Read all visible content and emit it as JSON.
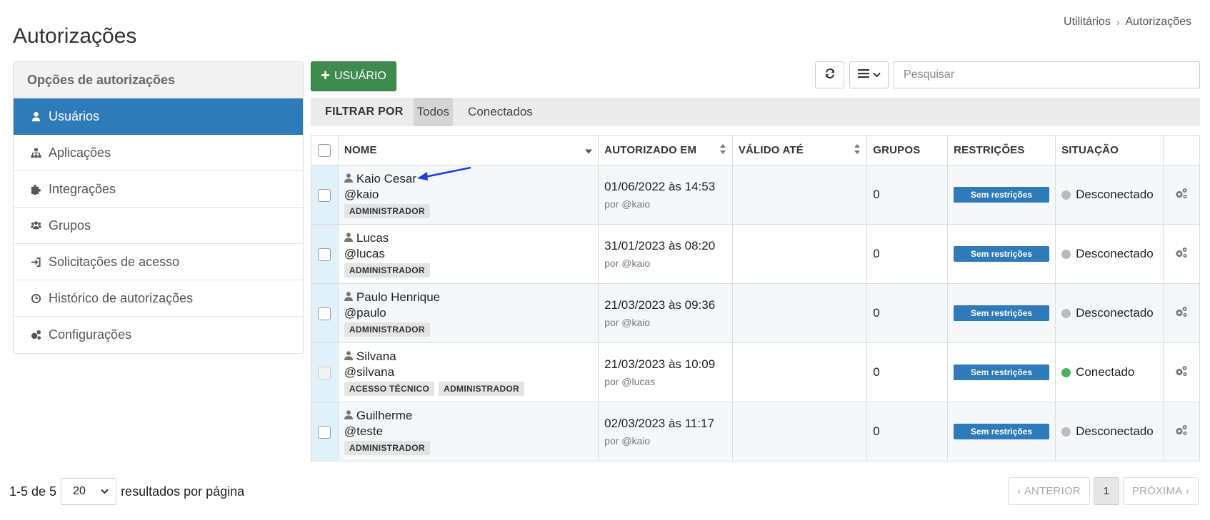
{
  "page": {
    "title": "Autorizações"
  },
  "breadcrumb": {
    "items": [
      "Utilitários",
      "Autorizações"
    ]
  },
  "sidebar": {
    "heading": "Opções de autorizações",
    "items": [
      {
        "label": "Usuários",
        "icon": "user-icon",
        "active": true
      },
      {
        "label": "Aplicações",
        "icon": "sitemap-icon",
        "active": false
      },
      {
        "label": "Integrações",
        "icon": "puzzle-icon",
        "active": false
      },
      {
        "label": "Grupos",
        "icon": "users-icon",
        "active": false
      },
      {
        "label": "Solicitações de acesso",
        "icon": "sign-in-icon",
        "active": false
      },
      {
        "label": "Histórico de autorizações",
        "icon": "clock-icon",
        "active": false
      },
      {
        "label": "Configurações",
        "icon": "gears-icon",
        "active": false
      }
    ]
  },
  "toolbar": {
    "add_user_label": "USUÁRIO",
    "search_placeholder": "Pesquisar"
  },
  "filter": {
    "label": "FILTRAR POR",
    "options": [
      {
        "label": "Todos",
        "active": true
      },
      {
        "label": "Conectados",
        "active": false
      }
    ]
  },
  "table": {
    "columns": {
      "name": "NOME",
      "authorized_at": "AUTORIZADO EM",
      "valid_until": "VÁLIDO ATÉ",
      "groups": "GRUPOS",
      "restrictions": "RESTRIÇÕES",
      "status": "SITUAÇÃO"
    },
    "rows": [
      {
        "name": "Kaio Cesar",
        "handle": "@kaio",
        "tags": [
          "ADMINISTRADOR"
        ],
        "authorized_at": "01/06/2022 às 14:53",
        "authorized_by": "por @kaio",
        "valid_until": "",
        "groups": "0",
        "restrictions": "Sem restrições",
        "status": "Desconectado",
        "connected": false
      },
      {
        "name": "Lucas",
        "handle": "@lucas",
        "tags": [
          "ADMINISTRADOR"
        ],
        "authorized_at": "31/01/2023 às 08:20",
        "authorized_by": "por @kaio",
        "valid_until": "",
        "groups": "0",
        "restrictions": "Sem restrições",
        "status": "Desconectado",
        "connected": false
      },
      {
        "name": "Paulo Henrique",
        "handle": "@paulo",
        "tags": [
          "ADMINISTRADOR"
        ],
        "authorized_at": "21/03/2023 às 09:36",
        "authorized_by": "por @kaio",
        "valid_until": "",
        "groups": "0",
        "restrictions": "Sem restrições",
        "status": "Desconectado",
        "connected": false
      },
      {
        "name": "Silvana",
        "handle": "@silvana",
        "tags": [
          "ACESSO TÉCNICO",
          "ADMINISTRADOR"
        ],
        "authorized_at": "21/03/2023 às 10:09",
        "authorized_by": "por @lucas",
        "valid_until": "",
        "groups": "0",
        "restrictions": "Sem restrições",
        "status": "Conectado",
        "connected": true
      },
      {
        "name": "Guilherme",
        "handle": "@teste",
        "tags": [
          "ADMINISTRADOR"
        ],
        "authorized_at": "02/03/2023 às 11:17",
        "authorized_by": "por @kaio",
        "valid_until": "",
        "groups": "0",
        "restrictions": "Sem restrições",
        "status": "Desconectado",
        "connected": false
      }
    ]
  },
  "footer": {
    "range": "1-5 de 5",
    "per_page_value": "20",
    "per_page_suffix": "resultados por página",
    "prev_label": "ANTERIOR",
    "current_page": "1",
    "next_label": "PRÓXIMA"
  },
  "colors": {
    "accent": "#2f7ab8",
    "add_button": "#3f8a4f",
    "connected": "#4fae5c",
    "disconnected": "#bbbbbb",
    "annotation_arrow": "#1a3fd8"
  }
}
